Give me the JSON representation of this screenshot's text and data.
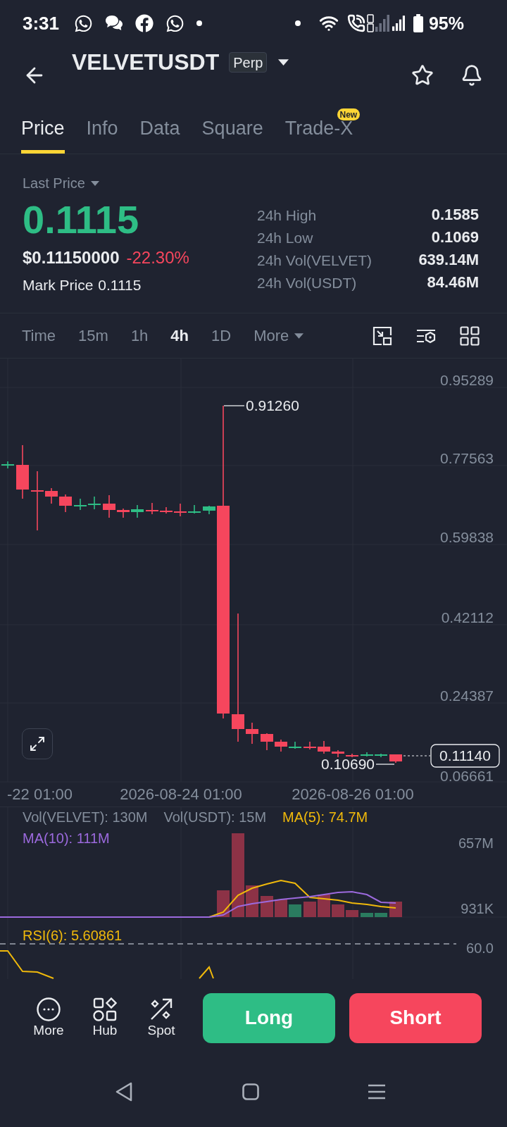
{
  "status_bar": {
    "time": "3:31",
    "battery": "95%"
  },
  "header": {
    "symbol": "VELVETUSDT",
    "contract_type": "Perp"
  },
  "tabs": [
    {
      "label": "Price",
      "selected": true
    },
    {
      "label": "Info",
      "selected": false
    },
    {
      "label": "Data",
      "selected": false
    },
    {
      "label": "Square",
      "selected": false
    },
    {
      "label": "Trade-X",
      "selected": false,
      "badge": "New"
    }
  ],
  "price": {
    "selector": "Last Price",
    "last_price": "0.1115",
    "usd_value": "$0.11150000",
    "change": "-22.30%",
    "mark_price_label": "Mark Price",
    "mark_price": "0.1115"
  },
  "stats": [
    {
      "label": "24h High",
      "value": "0.1585"
    },
    {
      "label": "24h Low",
      "value": "0.1069"
    },
    {
      "label": "24h Vol(VELVET)",
      "value": "639.14M"
    },
    {
      "label": "24h Vol(USDT)",
      "value": "84.46M"
    }
  ],
  "intervals": [
    {
      "label": "Time",
      "kind": "option",
      "selected": false
    },
    {
      "label": "15m",
      "kind": "option",
      "selected": false
    },
    {
      "label": "1h",
      "kind": "option",
      "selected": false
    },
    {
      "label": "4h",
      "kind": "option",
      "selected": true
    },
    {
      "label": "1D",
      "kind": "option",
      "selected": false
    },
    {
      "label": "More",
      "kind": "dropdown",
      "selected": false
    }
  ],
  "chart": {
    "price_axis_labels": [
      "0.95289",
      "0.77563",
      "0.59838",
      "0.42112",
      "0.24387",
      "0.06661"
    ],
    "time_axis_labels": [
      "-22 01:00",
      "2026-08-24 01:00",
      "2026-08-26 01:00"
    ],
    "high_label": "0.91260",
    "low_label": "0.10690",
    "current_price": "0.11140"
  },
  "volume": {
    "legend": [
      {
        "text": "Vol(VELVET): 130M",
        "color": "#848e9c"
      },
      {
        "text": "Vol(USDT): 15M",
        "color": "#848e9c"
      },
      {
        "text": "MA(5): 74.7M",
        "color": "#f0b90b"
      },
      {
        "text": "MA(10): 111M",
        "color": "#9c6ade"
      }
    ],
    "axis_labels": [
      "657M",
      "931K"
    ]
  },
  "rsi": {
    "label": "RSI(6): 5.60861",
    "level_label": "60.0"
  },
  "bottom_bar": {
    "shortcuts": [
      {
        "label": "More"
      },
      {
        "label": "Hub"
      },
      {
        "label": "Spot"
      }
    ],
    "actions": [
      {
        "label": "Long",
        "kind": "long"
      },
      {
        "label": "Short",
        "kind": "short"
      }
    ]
  }
}
